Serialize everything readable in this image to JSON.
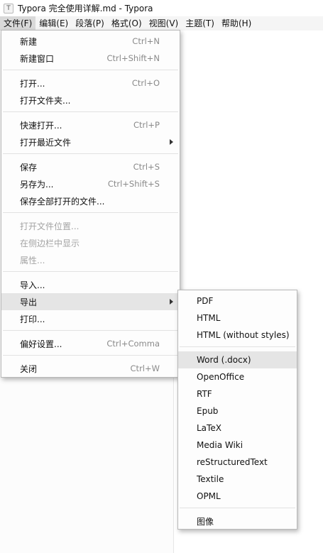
{
  "window": {
    "icon_glyph": "T",
    "title": "Typora 完全使用详解.md - Typora"
  },
  "menubar": [
    {
      "label": "文件(F)"
    },
    {
      "label": "编辑(E)"
    },
    {
      "label": "段落(P)"
    },
    {
      "label": "格式(O)"
    },
    {
      "label": "视图(V)"
    },
    {
      "label": "主题(T)"
    },
    {
      "label": "帮助(H)"
    }
  ],
  "file_menu": [
    {
      "label": "新建",
      "shortcut": "Ctrl+N"
    },
    {
      "label": "新建窗口",
      "shortcut": "Ctrl+Shift+N"
    },
    {
      "label": "打开...",
      "shortcut": "Ctrl+O"
    },
    {
      "label": "打开文件夹...",
      "shortcut": ""
    },
    {
      "label": "快速打开...",
      "shortcut": "Ctrl+P"
    },
    {
      "label": "打开最近文件",
      "shortcut": ""
    },
    {
      "label": "保存",
      "shortcut": "Ctrl+S"
    },
    {
      "label": "另存为...",
      "shortcut": "Ctrl+Shift+S"
    },
    {
      "label": "保存全部打开的文件...",
      "shortcut": ""
    },
    {
      "label": "打开文件位置...",
      "shortcut": ""
    },
    {
      "label": "在侧边栏中显示",
      "shortcut": ""
    },
    {
      "label": "属性...",
      "shortcut": ""
    },
    {
      "label": "导入...",
      "shortcut": ""
    },
    {
      "label": "导出",
      "shortcut": ""
    },
    {
      "label": "打印...",
      "shortcut": ""
    },
    {
      "label": "偏好设置...",
      "shortcut": "Ctrl+Comma"
    },
    {
      "label": "关闭",
      "shortcut": "Ctrl+W"
    }
  ],
  "export_menu": [
    {
      "label": "PDF"
    },
    {
      "label": "HTML"
    },
    {
      "label": "HTML (without styles)"
    },
    {
      "label": "Word (.docx)"
    },
    {
      "label": "OpenOffice"
    },
    {
      "label": "RTF"
    },
    {
      "label": "Epub"
    },
    {
      "label": "LaTeX"
    },
    {
      "label": "Media Wiki"
    },
    {
      "label": "reStructuredText"
    },
    {
      "label": "Textile"
    },
    {
      "label": "OPML"
    },
    {
      "label": "图像"
    }
  ],
  "colors": {
    "highlight": "#e5e5e5",
    "menubar_bg": "#f5f5f5",
    "disabled_text": "#a4a4a4",
    "shortcut_text": "#8a8a8a"
  }
}
